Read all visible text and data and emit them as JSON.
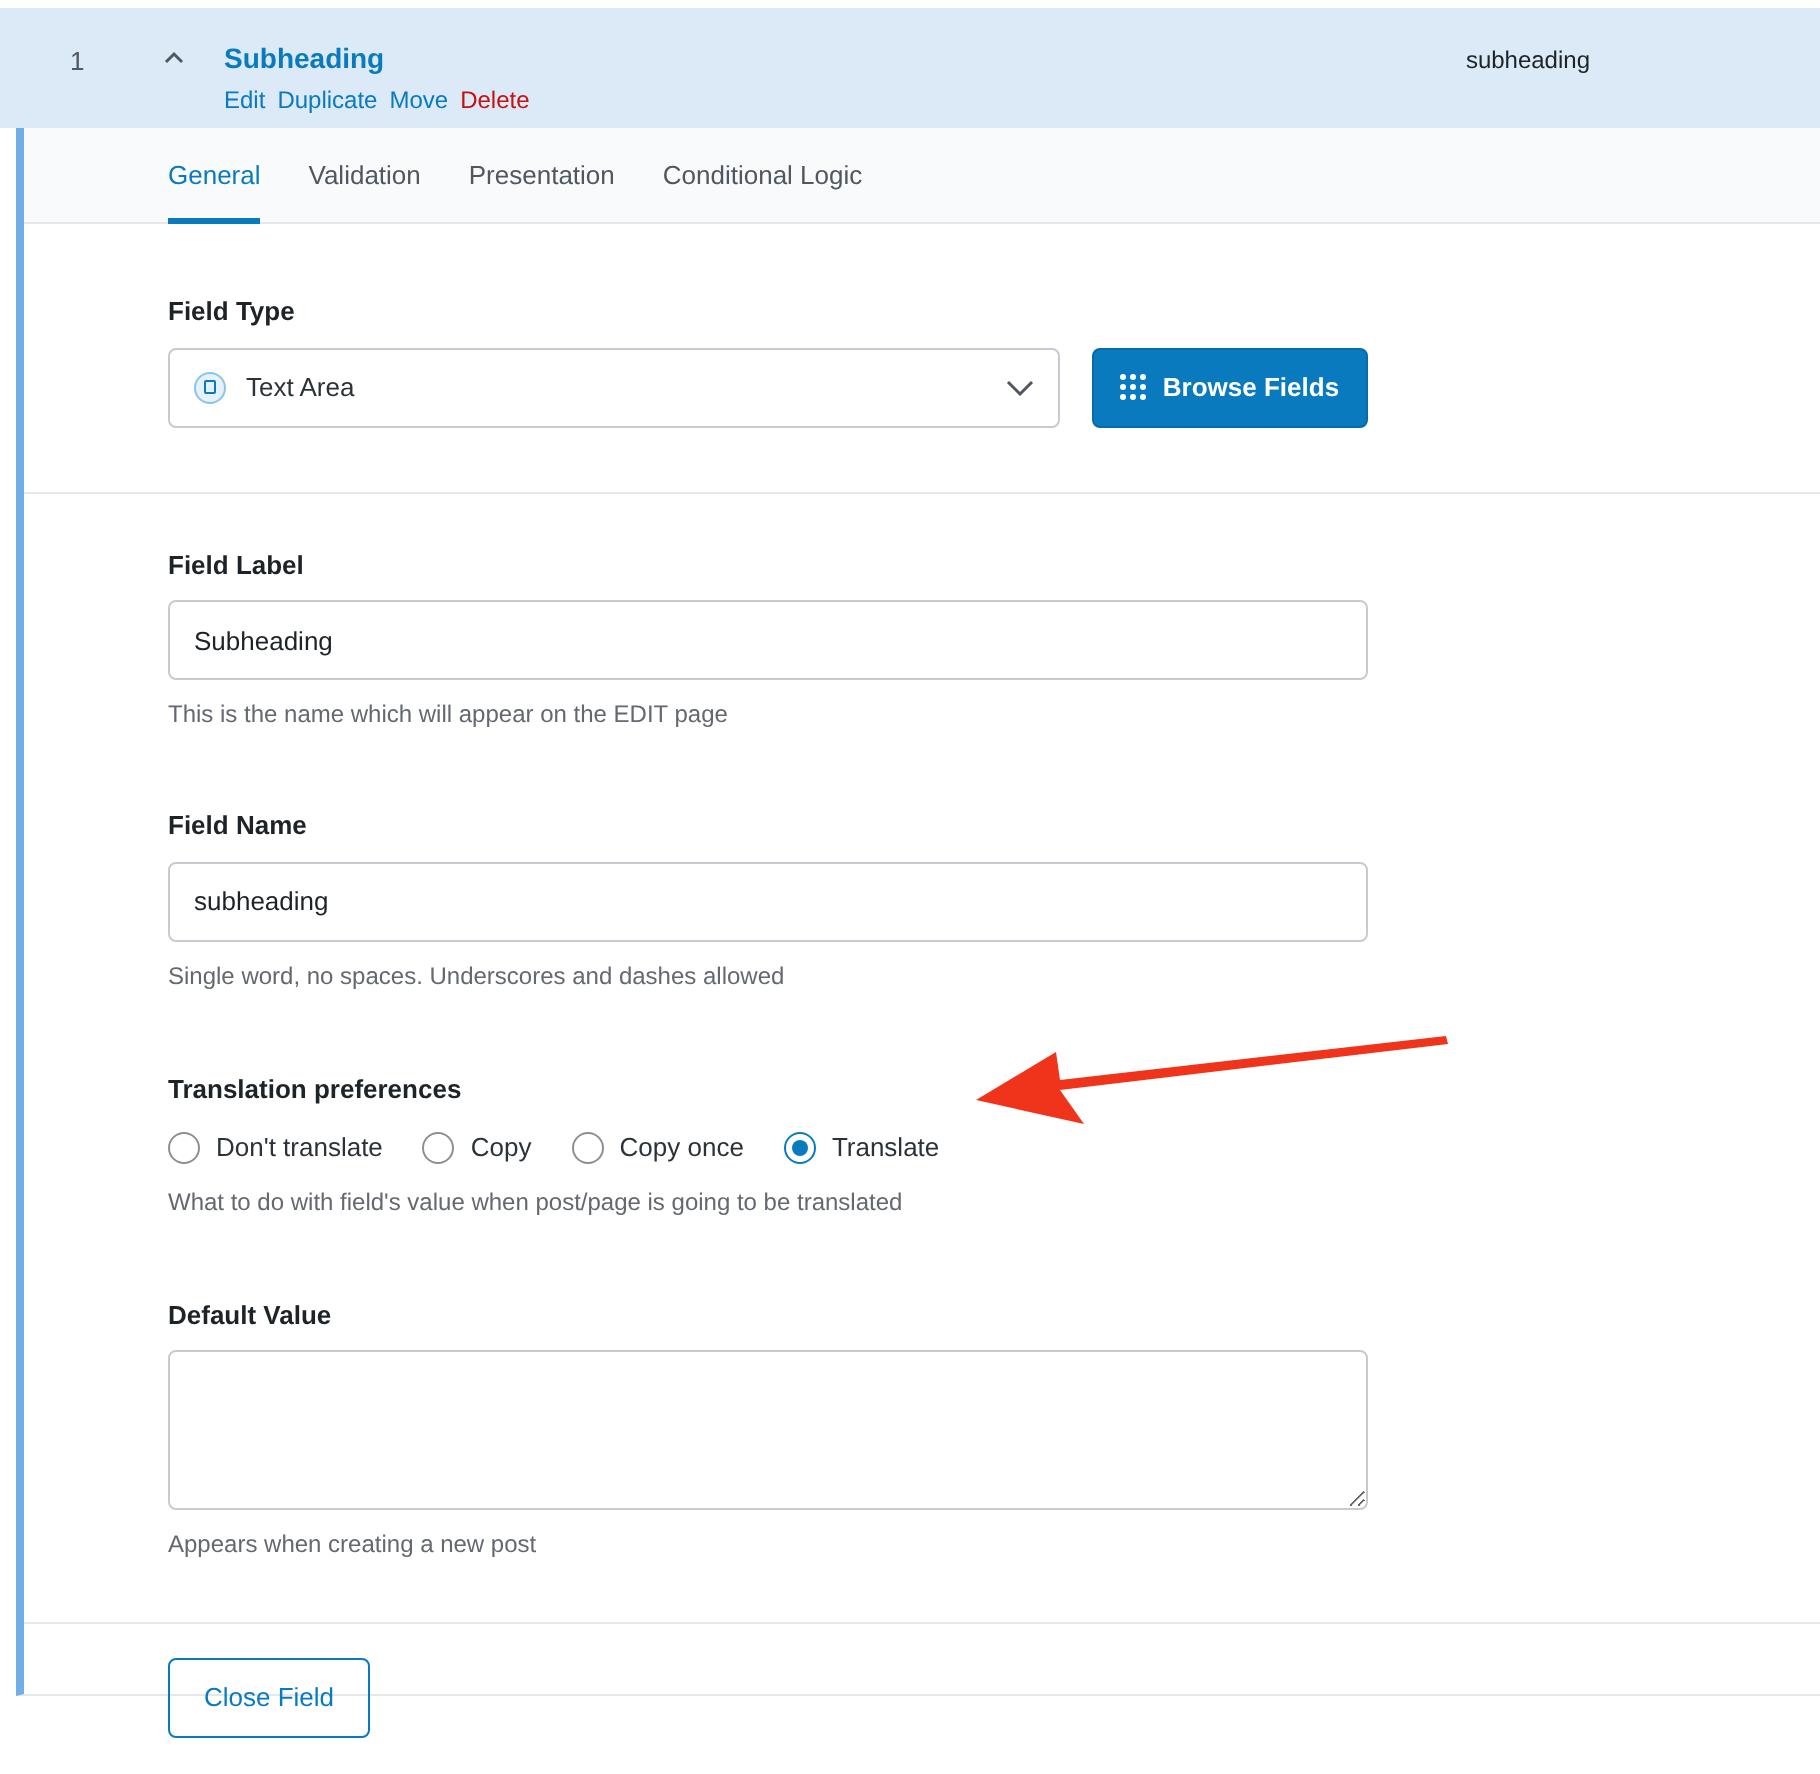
{
  "field_header": {
    "order": "1",
    "expanded": true,
    "label": "Subheading",
    "actions": [
      {
        "label": "Edit",
        "kind": "normal"
      },
      {
        "label": "Duplicate",
        "kind": "normal"
      },
      {
        "label": "Move",
        "kind": "normal"
      },
      {
        "label": "Delete",
        "kind": "danger"
      }
    ],
    "name": "subheading"
  },
  "tabs": [
    {
      "label": "General",
      "selected": true
    },
    {
      "label": "Validation",
      "selected": false
    },
    {
      "label": "Presentation",
      "selected": false
    },
    {
      "label": "Conditional Logic",
      "selected": false
    }
  ],
  "field_type": {
    "label": "Field Type",
    "value": "Text Area",
    "button": "Browse Fields"
  },
  "field_label": {
    "label": "Field Label",
    "value": "Subheading",
    "hint": "This is the name which will appear on the EDIT page"
  },
  "field_name": {
    "label": "Field Name",
    "value": "subheading",
    "hint": "Single word, no spaces. Underscores and dashes allowed"
  },
  "translation": {
    "label": "Translation preferences",
    "options": [
      {
        "label": "Don't translate",
        "selected": false
      },
      {
        "label": "Copy",
        "selected": false
      },
      {
        "label": "Copy once",
        "selected": false
      },
      {
        "label": "Translate",
        "selected": true
      }
    ],
    "hint": "What to do with field's value when post/page is going to be translated"
  },
  "default_value": {
    "label": "Default Value",
    "hint": "Appears when creating a new post"
  },
  "close_button": "Close Field"
}
